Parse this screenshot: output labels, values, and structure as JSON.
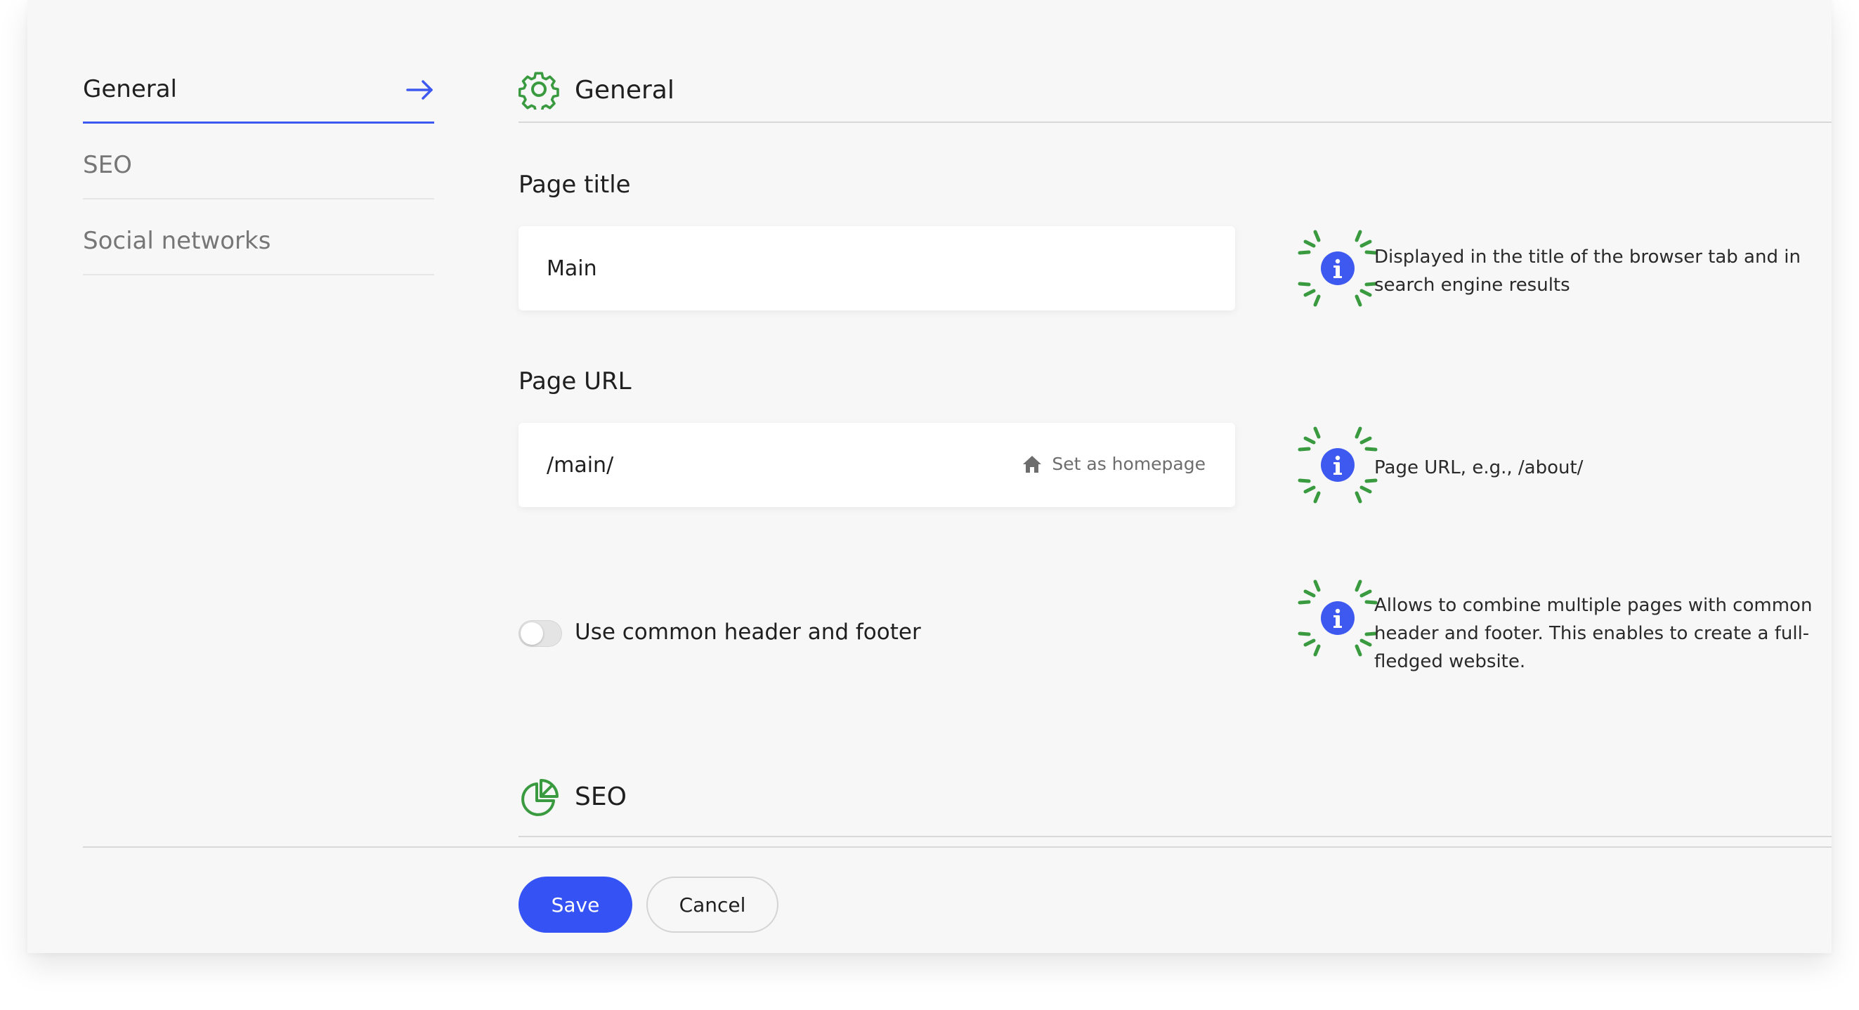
{
  "colors": {
    "accent": "#3553f5",
    "icon_green": "#3a9a3f",
    "hint_blue": "#3e59f0"
  },
  "sidebar": {
    "items": [
      {
        "label": "General",
        "active": true,
        "icon": "arrow-right-icon"
      },
      {
        "label": "SEO",
        "active": false
      },
      {
        "label": "Social networks",
        "active": false
      }
    ]
  },
  "sections": {
    "general": {
      "title": "General",
      "icon": "gear-icon"
    },
    "seo": {
      "title": "SEO",
      "icon": "pie-chart-icon"
    }
  },
  "fields": {
    "page_title": {
      "label": "Page title",
      "value": "Main",
      "hint": "Displayed in the title of the browser tab and in search engine results"
    },
    "page_url": {
      "label": "Page URL",
      "value": "/main/",
      "homepage_label": "Set as homepage",
      "hint": "Page URL, e.g., /about/"
    },
    "common_header_footer": {
      "label": "Use common header and footer",
      "enabled": false,
      "hint": "Allows to combine multiple pages with common header and footer. This enables to create a full-fledged website."
    }
  },
  "actions": {
    "save_label": "Save",
    "cancel_label": "Cancel"
  }
}
